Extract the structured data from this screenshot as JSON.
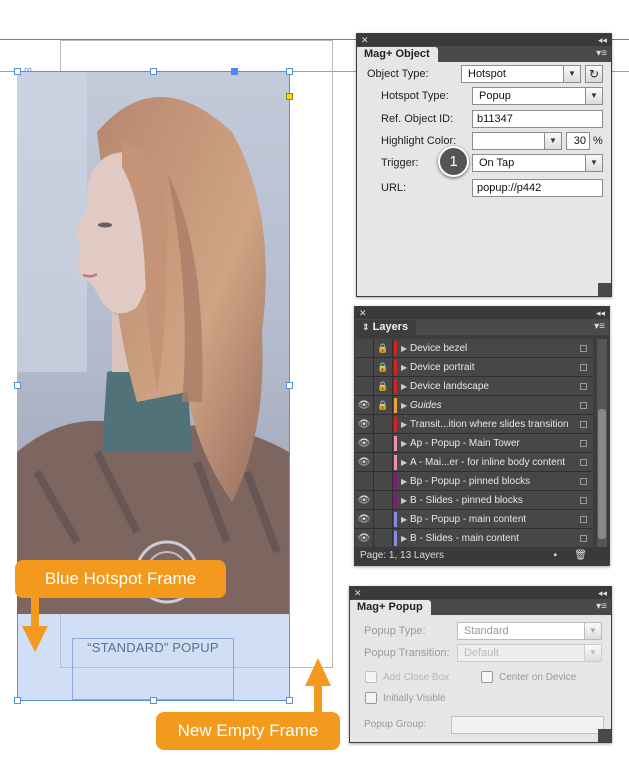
{
  "callouts": {
    "blue_hotspot": "Blue Hotspot Frame",
    "new_empty_frame": "New Empty Frame"
  },
  "canvas": {
    "standard_popup_label": "“STANDARD” POPUP"
  },
  "mag_object_panel": {
    "title": "Mag+ Object",
    "object_type_label": "Object Type:",
    "object_type_value": "Hotspot",
    "hotspot_type_label": "Hotspot Type:",
    "hotspot_type_value": "Popup",
    "ref_object_id_label": "Ref. Object ID:",
    "ref_object_id_value": "b11347",
    "highlight_color_label": "Highlight Color:",
    "highlight_color_value": "",
    "highlight_percent_value": "30",
    "percent_sign": "%",
    "trigger_label": "Trigger:",
    "trigger_value": "On Tap",
    "url_label": "URL:",
    "url_value": "popup://p442",
    "step_badge": "1"
  },
  "layers_panel": {
    "title": "Layers",
    "footer_text": "Page: 1, 13 Layers",
    "layers": [
      {
        "name": "Device bezel",
        "visible": false,
        "locked": true,
        "color": "#d42020",
        "italic": false
      },
      {
        "name": "Device portrait",
        "visible": false,
        "locked": true,
        "color": "#d42020",
        "italic": false
      },
      {
        "name": "Device landscape",
        "visible": false,
        "locked": true,
        "color": "#d42020",
        "italic": false
      },
      {
        "name": "Guides",
        "visible": true,
        "locked": true,
        "color": "#e8a23a",
        "italic": true
      },
      {
        "name": "Transit...ition where slides transition",
        "visible": true,
        "locked": false,
        "color": "#d42020",
        "italic": false
      },
      {
        "name": "Ap - Popup - Main Tower",
        "visible": true,
        "locked": false,
        "color": "#f08ab8",
        "italic": false
      },
      {
        "name": "A - Mai...er - for inline body content",
        "visible": true,
        "locked": false,
        "color": "#f08ab8",
        "italic": false
      },
      {
        "name": "Bp - Popup - pinned blocks",
        "visible": false,
        "locked": false,
        "color": "#7a1f7a",
        "italic": false
      },
      {
        "name": "B - Slides - pinned blocks",
        "visible": true,
        "locked": false,
        "color": "#7a1f7a",
        "italic": false
      },
      {
        "name": "Bp - Popup - main content",
        "visible": true,
        "locked": false,
        "color": "#8a8ae0",
        "italic": false
      },
      {
        "name": "B - Slides - main content",
        "visible": true,
        "locked": false,
        "color": "#8a8ae0",
        "italic": false
      }
    ]
  },
  "popup_panel": {
    "title": "Mag+ Popup",
    "popup_type_label": "Popup Type:",
    "popup_type_value": "Standard",
    "popup_transition_label": "Popup Transition:",
    "popup_transition_value": "Default",
    "add_close_box_label": "Add Close Box",
    "center_on_device_label": "Center on Device",
    "initially_visible_label": "Initially Visible",
    "popup_group_label": "Popup Group:",
    "popup_group_value": ""
  },
  "colors": {
    "callout_orange": "#f39a1e",
    "hotspot_blue": "#5b8fdc",
    "guide_magenta": "#e040c0",
    "guide_cyan": "#28d0d8"
  }
}
